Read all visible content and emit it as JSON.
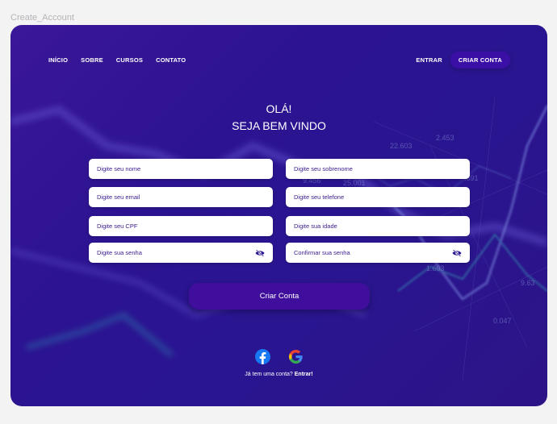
{
  "frame_label": "Create_Account",
  "nav": {
    "links": [
      "INÍCIO",
      "SOBRE",
      "CURSOS",
      "CONTATO"
    ],
    "login_label": "ENTRAR",
    "signup_label": "CRIAR CONTA"
  },
  "greeting": {
    "line1": "OLÁ!",
    "line2": "SEJA BEM VINDO"
  },
  "form": {
    "first_name_placeholder": "Digite seu nome",
    "last_name_placeholder": "Digite seu sobrenome",
    "email_placeholder": "Digite seu email",
    "phone_placeholder": "Digite seu telefone",
    "cpf_placeholder": "Digite seu CPF",
    "age_placeholder": "Digite sua idade",
    "password_placeholder": "Digite sua senha",
    "confirm_password_placeholder": "Confirmar sua senha",
    "submit_label": "Criar Conta"
  },
  "social": {
    "icons": [
      "facebook-icon",
      "google-icon"
    ]
  },
  "footer": {
    "prompt": "Já tem uma conta?",
    "link": "Entrar!"
  },
  "colors": {
    "background": "#2c1391",
    "button": "#3f0e9c",
    "field": "#ffffff"
  }
}
